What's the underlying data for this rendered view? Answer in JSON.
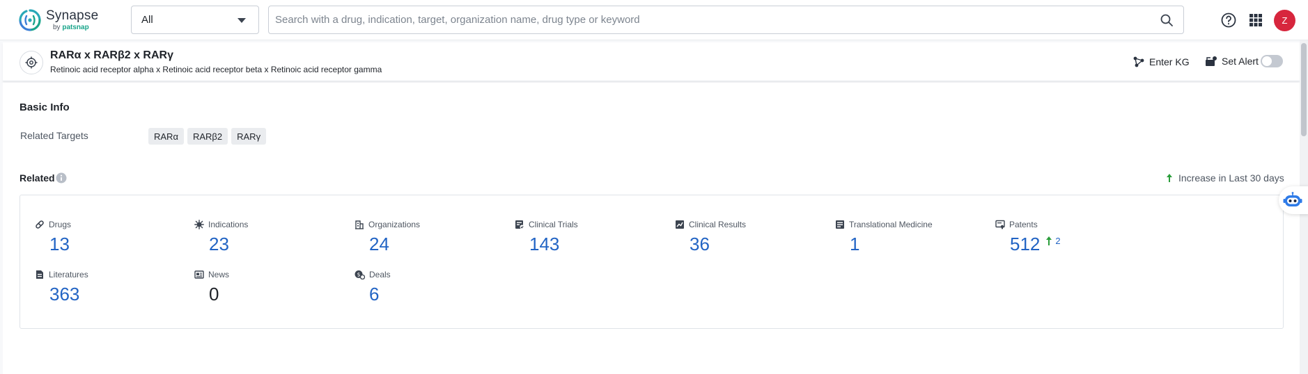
{
  "app": {
    "name": "Synapse",
    "sub_prefix": "by",
    "sub_brand": "patsnap"
  },
  "search": {
    "scope_selected": "All",
    "placeholder": "Search with a drug, indication, target, organization name, drug type or keyword",
    "value": ""
  },
  "user": {
    "avatar_initial": "Z"
  },
  "target": {
    "title": "RARα x RARβ2 x RARγ",
    "subtitle": "Retinoic acid receptor alpha x Retinoic acid receptor beta x Retinoic acid receptor gamma",
    "enter_kg_label": "Enter KG",
    "set_alert_label": "Set Alert",
    "alert_enabled": false
  },
  "basic_info": {
    "title": "Basic Info",
    "related_targets_label": "Related Targets",
    "related_targets": [
      "RARα",
      "RARβ2",
      "RARγ"
    ]
  },
  "related": {
    "title": "Related",
    "increase_legend": "Increase in Last 30 days",
    "stats": [
      {
        "label": "Drugs",
        "value": "13",
        "icon": "pill-icon"
      },
      {
        "label": "Indications",
        "value": "23",
        "icon": "virus-icon"
      },
      {
        "label": "Organizations",
        "value": "24",
        "icon": "building-icon"
      },
      {
        "label": "Clinical Trials",
        "value": "143",
        "icon": "clinical-trials-icon"
      },
      {
        "label": "Clinical Results",
        "value": "36",
        "icon": "clinical-results-icon"
      },
      {
        "label": "Translational Medicine",
        "value": "1",
        "icon": "translational-medicine-icon"
      },
      {
        "label": "Patents",
        "value": "512",
        "icon": "patent-icon",
        "increase": "2"
      },
      {
        "label": "Literatures",
        "value": "363",
        "icon": "document-icon"
      },
      {
        "label": "News",
        "value": "0",
        "icon": "newspaper-icon"
      },
      {
        "label": "Deals",
        "value": "6",
        "icon": "deal-icon"
      }
    ]
  },
  "colors": {
    "accent_blue": "#2264c4",
    "increase_green": "#2a9d3a",
    "avatar_red": "#d7263d",
    "brand_teal": "#1aa58b"
  }
}
